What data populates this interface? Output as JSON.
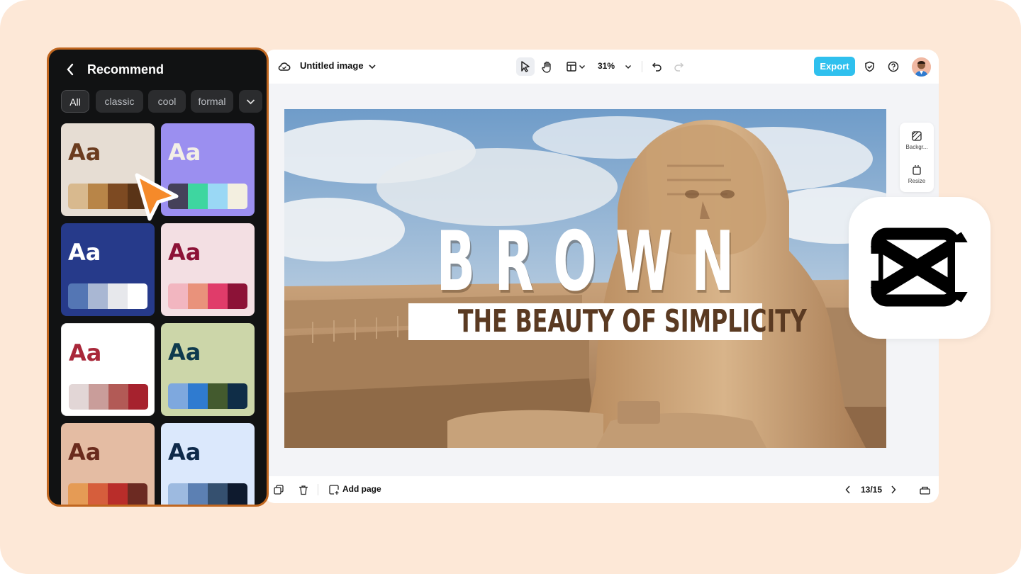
{
  "topbar": {
    "cloud_icon": "cloud-icon",
    "doc_title": "Untitled image",
    "zoom": "31%",
    "export_label": "Export"
  },
  "side_tools": [
    {
      "label": "Backgr...",
      "icon": "background-icon"
    },
    {
      "label": "Resize",
      "icon": "resize-icon"
    }
  ],
  "canvas": {
    "title": "BROWN",
    "subtitle": "THE BEAUTY OF SIMPLICITY"
  },
  "bottombar": {
    "add_page_label": "Add page",
    "page_indicator": "13/15"
  },
  "panel": {
    "title": "Recommend",
    "chips": [
      "All",
      "classic",
      "cool",
      "formal"
    ],
    "active_chip": "All",
    "cards": [
      {
        "aa": "Aa",
        "bg": "#e6ddd3",
        "text_color": "#6b3c1f",
        "swatches": [
          "#d8b98e",
          "#b88548",
          "#7d4a22",
          "#5a3417"
        ]
      },
      {
        "aa": "Aa",
        "bg": "#9b8ff0",
        "text_color": "#f3efe6",
        "swatches": [
          "#45415a",
          "#3ed6a0",
          "#9ad8f5",
          "#f3efe0"
        ]
      },
      {
        "aa": "Aa",
        "bg": "#263a8a",
        "text_color": "#ffffff",
        "swatches": [
          "#5476b4",
          "#a9b7d3",
          "#e7e8ec",
          "#ffffff"
        ]
      },
      {
        "aa": "Aa",
        "bg": "#f3dfe3",
        "text_color": "#8c1237",
        "swatches": [
          "#f2b6c0",
          "#e9927b",
          "#e03c6a",
          "#8c1237"
        ]
      },
      {
        "aa": "Aa",
        "bg": "#ffffff",
        "text_color": "#a9283a",
        "swatches": [
          "#e2d6d6",
          "#c99d9a",
          "#b25a56",
          "#a6222e"
        ]
      },
      {
        "aa": "Aa",
        "bg": "#ccd6a9",
        "text_color": "#0e3a4e",
        "swatches": [
          "#7ea8de",
          "#2f7bd0",
          "#435a2e",
          "#0f2d47"
        ]
      },
      {
        "aa": "Aa",
        "bg": "#e4bca3",
        "text_color": "#6a2b1d",
        "swatches": [
          "#e59b55",
          "#d65e3c",
          "#b92d2a",
          "#6c2a22"
        ]
      },
      {
        "aa": "Aa",
        "bg": "#dbe8fc",
        "text_color": "#0f2a4a",
        "swatches": [
          "#9dbae0",
          "#5c80b3",
          "#35506f",
          "#0e1a2e"
        ]
      }
    ]
  },
  "colors": {
    "accent": "#2fc0ee",
    "panel_border": "#c0661f",
    "cursor": "#f58a2a"
  }
}
